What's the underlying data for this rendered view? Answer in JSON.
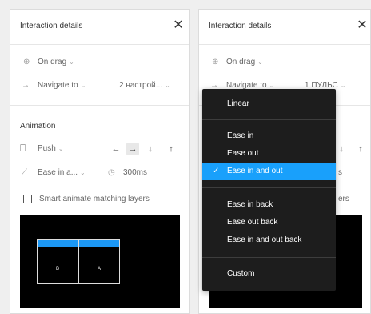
{
  "left_panel": {
    "title": "Interaction details",
    "trigger": "On drag",
    "action": "Navigate to",
    "destination": "2 настрой...",
    "section_title": "Animation",
    "animation_type": "Push",
    "directions": [
      "←",
      "→",
      "↓",
      "↑"
    ],
    "easing": "Ease in a...",
    "duration": "300ms",
    "smart_animate_label": "Smart animate matching layers",
    "preview_frames": [
      "B",
      "A"
    ]
  },
  "right_panel": {
    "title": "Interaction details",
    "trigger": "On drag",
    "action": "Navigate to",
    "destination": "1 ПУЛЬС",
    "partial_dir1": "↓",
    "partial_dir2": "↑",
    "partial_duration": "s",
    "partial_smart": "ers"
  },
  "icons": {
    "close": "✕",
    "chevron": "⌄",
    "drag": "⊕",
    "arrow_right": "→",
    "checkmark": "✓",
    "push": "⎕",
    "clock": "◷",
    "easing_curve": "⟋"
  },
  "dropdown": {
    "items": [
      {
        "label": "Linear"
      },
      {
        "label": "Ease in"
      },
      {
        "label": "Ease out"
      },
      {
        "label": "Ease in and out",
        "selected": true
      },
      {
        "label": "Ease in back"
      },
      {
        "label": "Ease out back"
      },
      {
        "label": "Ease in and out back"
      },
      {
        "label": "Custom"
      }
    ]
  },
  "colors": {
    "accent": "#19a0fb",
    "dropdown_bg": "#1d1d1d",
    "panel_bg": "#ffffff",
    "preview_bg": "#000000"
  }
}
